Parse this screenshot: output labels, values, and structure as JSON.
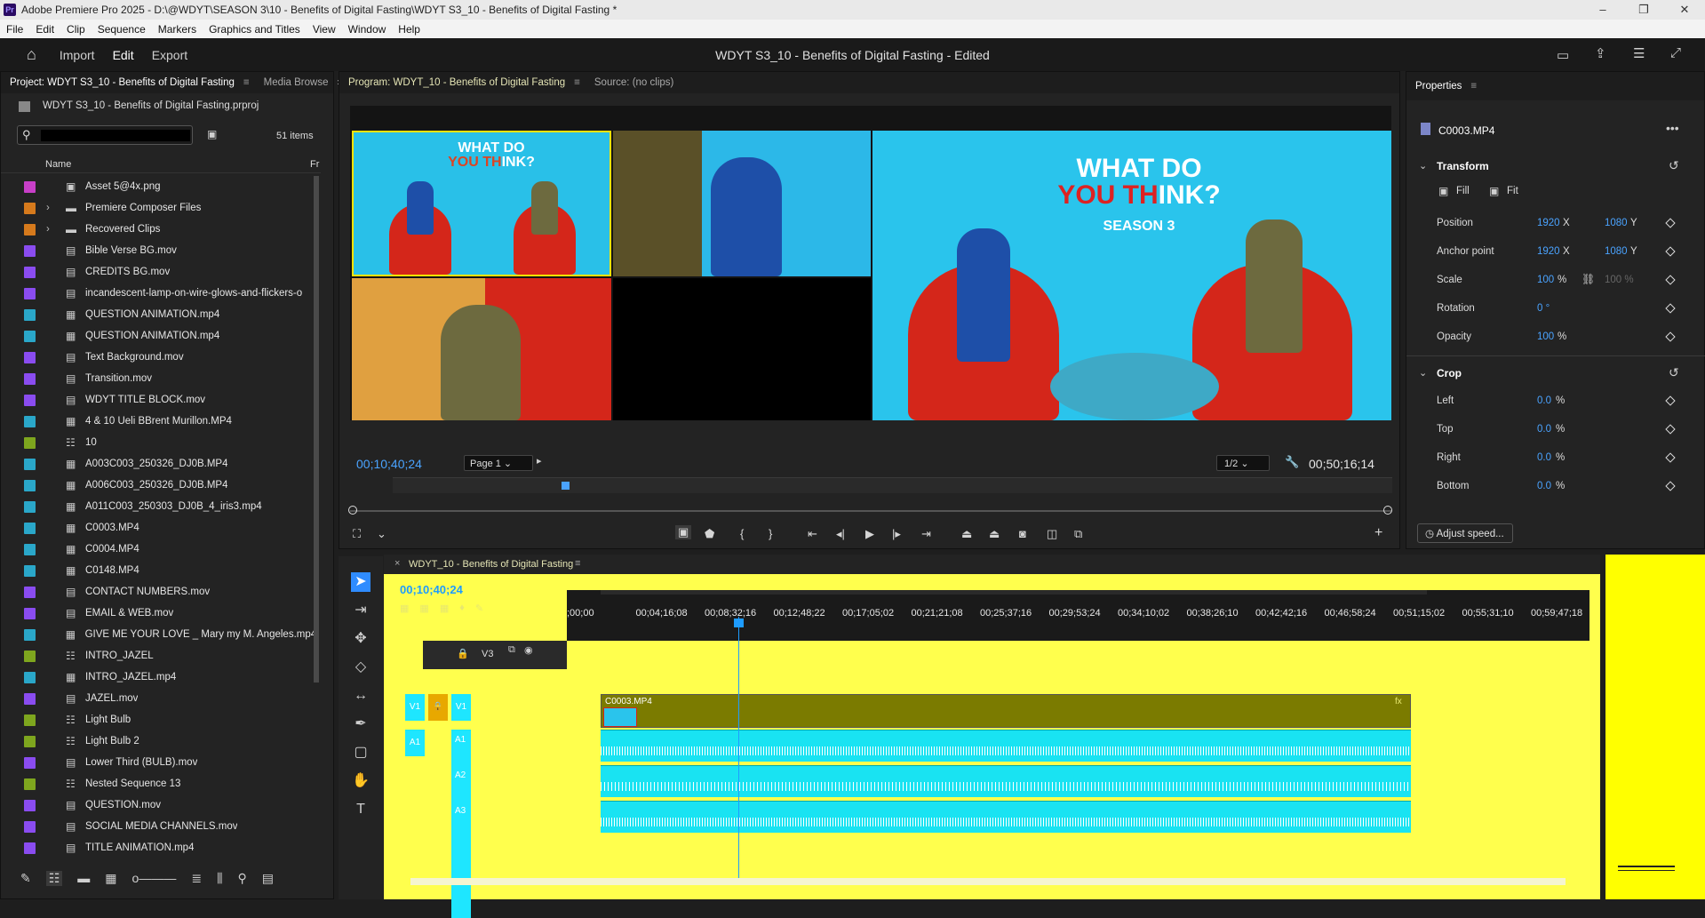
{
  "window": {
    "title": "Adobe Premiere Pro 2025 - D:\\@WDYT\\SEASON 3\\10 - Benefits of Digital Fasting\\WDYT S3_10 - Benefits of Digital Fasting *",
    "logo": "Pr"
  },
  "menu": [
    "File",
    "Edit",
    "Clip",
    "Sequence",
    "Markers",
    "Graphics and Titles",
    "View",
    "Window",
    "Help"
  ],
  "workspace": {
    "tabs": [
      "Import",
      "Edit",
      "Export"
    ],
    "active": "Edit",
    "doc_title": "WDYT S3_10 - Benefits of Digital Fasting - Edited"
  },
  "project": {
    "tabs": [
      "Project: WDYT S3_10 - Benefits of Digital Fasting",
      "Media Browse"
    ],
    "file": "WDYT S3_10 - Benefits of Digital Fasting.prproj",
    "item_count": "51 items",
    "col_name": "Name",
    "col_fr": "Fr",
    "items": [
      {
        "name": "Asset 5@4x.png",
        "color": "#c83fc8",
        "kind": "img"
      },
      {
        "name": "Premiere Composer Files",
        "color": "#d67a1c",
        "kind": "folder"
      },
      {
        "name": "Recovered Clips",
        "color": "#d67a1c",
        "kind": "folder"
      },
      {
        "name": "Bible Verse BG.mov",
        "color": "#8a4cf0",
        "kind": "clip"
      },
      {
        "name": "CREDITS BG.mov",
        "color": "#8a4cf0",
        "kind": "clip"
      },
      {
        "name": "incandescent-lamp-on-wire-glows-and-flickers-o",
        "color": "#8a4cf0",
        "kind": "clip"
      },
      {
        "name": "QUESTION ANIMATION.mp4",
        "color": "#2aa7c9",
        "kind": "av"
      },
      {
        "name": "QUESTION ANIMATION.mp4",
        "color": "#2aa7c9",
        "kind": "av"
      },
      {
        "name": "Text Background.mov",
        "color": "#8a4cf0",
        "kind": "clip"
      },
      {
        "name": "Transition.mov",
        "color": "#8a4cf0",
        "kind": "clip"
      },
      {
        "name": "WDYT TITLE BLOCK.mov",
        "color": "#8a4cf0",
        "kind": "clip"
      },
      {
        "name": "4 & 10 Ueli BBrent Murillon.MP4",
        "color": "#2aa7c9",
        "kind": "av"
      },
      {
        "name": "10",
        "color": "#7ea61e",
        "kind": "seq"
      },
      {
        "name": "A003C003_250326_DJ0B.MP4",
        "color": "#2aa7c9",
        "kind": "av"
      },
      {
        "name": "A006C003_250326_DJ0B.MP4",
        "color": "#2aa7c9",
        "kind": "av"
      },
      {
        "name": "A011C003_250303_DJ0B_4_iris3.mp4",
        "color": "#2aa7c9",
        "kind": "av"
      },
      {
        "name": "C0003.MP4",
        "color": "#2aa7c9",
        "kind": "av"
      },
      {
        "name": "C0004.MP4",
        "color": "#2aa7c9",
        "kind": "av"
      },
      {
        "name": "C0148.MP4",
        "color": "#2aa7c9",
        "kind": "av"
      },
      {
        "name": "CONTACT NUMBERS.mov",
        "color": "#8a4cf0",
        "kind": "clip"
      },
      {
        "name": "EMAIL & WEB.mov",
        "color": "#8a4cf0",
        "kind": "clip"
      },
      {
        "name": "GIVE ME YOUR LOVE _ Mary my M. Angeles.mp4",
        "color": "#2aa7c9",
        "kind": "av"
      },
      {
        "name": "INTRO_JAZEL",
        "color": "#7ea61e",
        "kind": "seq"
      },
      {
        "name": "INTRO_JAZEL.mp4",
        "color": "#2aa7c9",
        "kind": "av"
      },
      {
        "name": "JAZEL.mov",
        "color": "#8a4cf0",
        "kind": "clip"
      },
      {
        "name": "Light Bulb",
        "color": "#7ea61e",
        "kind": "seq"
      },
      {
        "name": "Light Bulb 2",
        "color": "#7ea61e",
        "kind": "seq"
      },
      {
        "name": "Lower Third (BULB).mov",
        "color": "#8a4cf0",
        "kind": "clip"
      },
      {
        "name": "Nested Sequence 13",
        "color": "#7ea61e",
        "kind": "seq"
      },
      {
        "name": "QUESTION.mov",
        "color": "#8a4cf0",
        "kind": "clip"
      },
      {
        "name": "SOCIAL MEDIA CHANNELS.mov",
        "color": "#8a4cf0",
        "kind": "clip"
      },
      {
        "name": "TITLE ANIMATION.mp4",
        "color": "#8a4cf0",
        "kind": "clip"
      }
    ]
  },
  "program": {
    "tabs": [
      "Program: WDYT_10 - Benefits of Digital Fasting",
      "Source: (no clips)"
    ],
    "timecode": "00;10;40;24",
    "page": "Page 1",
    "resolution": "1/2",
    "duration": "00;50;16;14",
    "show_title_line1": "WHAT DO",
    "show_title_line2a": "YOU TH",
    "show_title_line2b": "INK?",
    "show_subtitle": "SEASON 3"
  },
  "properties": {
    "title": "Properties",
    "clip": "C0003.MP4",
    "transform": "Transform",
    "fill": "Fill",
    "fit": "Fit",
    "position_label": "Position",
    "position_x": "1920",
    "position_y": "1080",
    "anchor_label": "Anchor point",
    "anchor_x": "1920",
    "anchor_y": "1080",
    "scale_label": "Scale",
    "scale": "100",
    "scale2": "100 %",
    "rotation_label": "Rotation",
    "rotation": "0 °",
    "opacity_label": "Opacity",
    "opacity": "100",
    "x": "X",
    "y": "Y",
    "pct": "%",
    "crop": "Crop",
    "crop_left_label": "Left",
    "crop_left": "0.0",
    "crop_top_label": "Top",
    "crop_top": "0.0",
    "crop_right_label": "Right",
    "crop_right": "0.0",
    "crop_bottom_label": "Bottom",
    "crop_bottom": "0.0",
    "adjust_speed": "Adjust speed..."
  },
  "timeline": {
    "tab": "WDYT_10 - Benefits of Digital Fasting",
    "timecode": "00;10;40;24",
    "ruler": [
      ";00;00",
      "00;04;16;08",
      "00;08;32;16",
      "00;12;48;22",
      "00;17;05;02",
      "00;21;21;08",
      "00;25;37;16",
      "00;29;53;24",
      "00;34;10;02",
      "00;38;26;10",
      "00;42;42;16",
      "00;46;58;24",
      "00;51;15;02",
      "00;55;31;10",
      "00;59;47;18"
    ],
    "tracks": {
      "v3": "V3",
      "v1": "V1",
      "a1": "A1",
      "a2": "A2",
      "a3": "A3"
    },
    "clip_name": "C0003.MP4",
    "accent": "#ffff4d",
    "audio_color": "#19e3f2",
    "video_clip_color": "#7b7b00"
  }
}
